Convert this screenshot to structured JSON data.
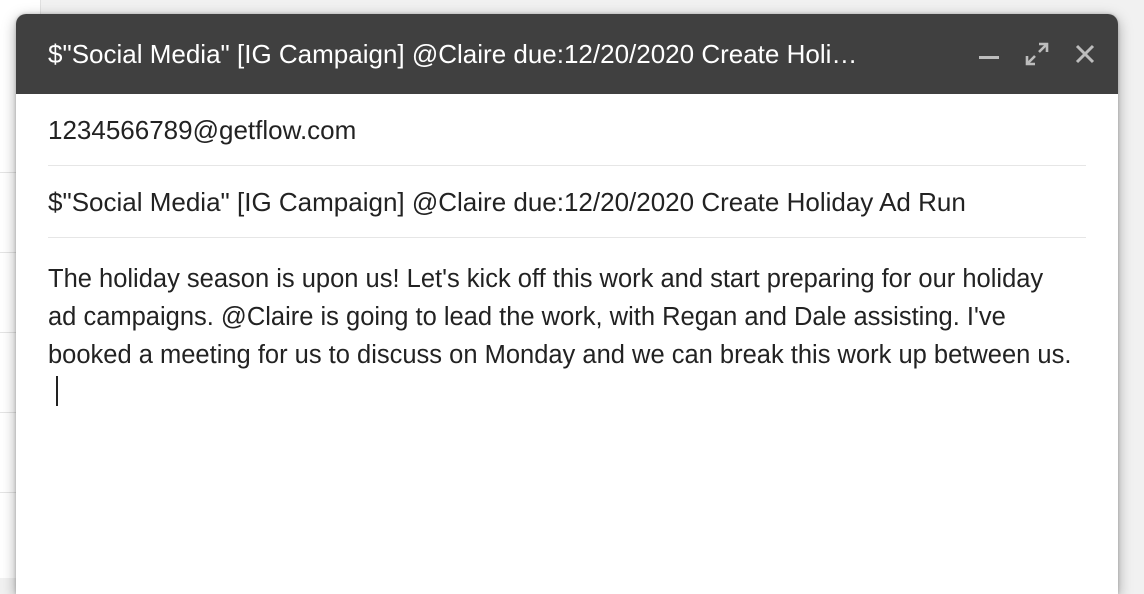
{
  "compose": {
    "title": "$\"Social Media\" [IG Campaign] @Claire due:12/20/2020 Create Holi…",
    "to": "1234566789@getflow.com",
    "subject": "$\"Social Media\" [IG Campaign] @Claire due:12/20/2020 Create Holiday Ad Run",
    "body": "The holiday season is upon us! Let's kick off this work and start preparing for our holiday ad campaigns. @Claire is going to lead the work, with Regan and Dale assisting. I've booked a meeting for us to discuss on Monday and we can break this work up between us."
  },
  "icons": {
    "minimize": "minimize-icon",
    "fullscreen": "expand-icon",
    "close": "close-icon"
  },
  "colors": {
    "titlebar": "#404040",
    "text": "#222222"
  }
}
